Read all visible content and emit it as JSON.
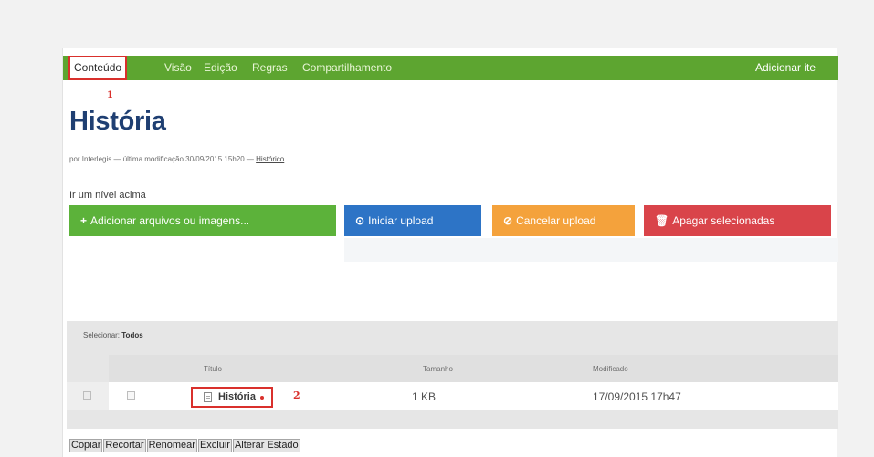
{
  "topnav": {
    "tabs": [
      {
        "label": "Conteúdo",
        "active": true
      },
      {
        "label": "Visão"
      },
      {
        "label": "Edição"
      },
      {
        "label": "Regras"
      },
      {
        "label": "Compartilhamento"
      }
    ],
    "add_item_label": "Adicionar ite"
  },
  "markers": {
    "one": "1",
    "two": "2"
  },
  "page": {
    "title": "História",
    "byline_prefix": "por Interlegis — última modificação 30/09/2015 15h20 —",
    "byline_history": "Histórico",
    "up_link": "Ir um nível acima"
  },
  "toolbar": {
    "add_files": "Adicionar arquivos ou imagens...",
    "start_upload": "Iniciar upload",
    "cancel_upload": "Cancelar upload",
    "delete_selected": "Apagar selecionadas"
  },
  "table": {
    "select_label": "Selecionar:",
    "select_all": "Todos",
    "columns": [
      "Título",
      "Tamanho",
      "Modificado"
    ],
    "rows": [
      {
        "title": "História",
        "size": "1 KB",
        "modified": "17/09/2015 17h47"
      }
    ]
  },
  "actions": [
    "Copiar",
    "Recortar",
    "Renomear",
    "Excluir",
    "Alterar Estado"
  ],
  "colors": {
    "nav_green": "#5da530",
    "highlight_red": "#d9302c",
    "title_blue": "#1f3f72"
  }
}
